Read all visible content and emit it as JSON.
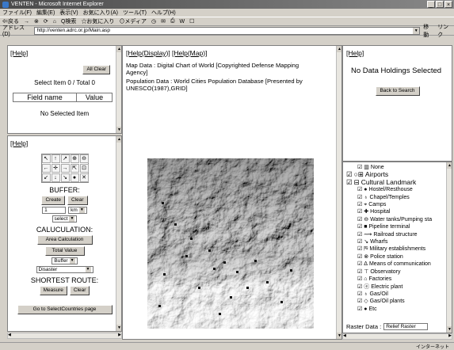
{
  "window": {
    "title": "VENTEN - Microsoft Internet Explorer",
    "min": "_",
    "max": "□",
    "close": "×"
  },
  "menu": [
    "ファイル(F)",
    "編集(E)",
    "表示(V)",
    "お気に入り(A)",
    "ツール(T)",
    "ヘルプ(H)"
  ],
  "toolbar": [
    "⇐戻る",
    "→",
    "⊗",
    "⟳",
    "⌂",
    "Q検索",
    "☆お気に入り",
    "⊙メディア",
    "◷",
    "✉",
    "⎙",
    "W",
    "☐"
  ],
  "address": {
    "label": "アドレス(D)",
    "url": "http://venten.adrc.or.jp/Main.asp",
    "go": "移動",
    "links": "リンク"
  },
  "top_left": {
    "help": "[Help]",
    "all_clear": "All Clear",
    "select_status": "Select Item 0 / Total 0",
    "col_field": "Field name",
    "col_value": "Value",
    "no_selected": "No Selected Item"
  },
  "tools": {
    "help": "[Help]",
    "icons": [
      "↖",
      "↑",
      "↗",
      "⊕",
      "⊖",
      "←",
      "✛",
      "→",
      "⇱",
      "⊡",
      "↙",
      "↓",
      "↘",
      "●",
      "✕"
    ],
    "buffer_title": "BUFFER:",
    "create": "Create",
    "clear": "Clear",
    "buffer_value": "1",
    "unit": "km",
    "select": "select",
    "calc_title": "CALUCULATION:",
    "area_calc": "Area Calculation",
    "total_value": "Total Value",
    "buffer_opt": "Buffer",
    "disaster": "Disaster",
    "route_title": "SHORTEST ROUTE:",
    "measure": "Measure",
    "route_clear": "Clear",
    "goto": "Go to SelectCountries page"
  },
  "map_panel": {
    "help_display": "[Help(Display)]",
    "help_map": "[Help(Map)]",
    "map_data": "Map Data : Digital Chart of World [Copyrighted Defense Mapping Agency]",
    "pop_data": "Population Data : World Cities Population Database [Presented by UNESCO(1987),GRID]"
  },
  "right_top": {
    "help": "[Help]",
    "no_data": "No Data Holdings Selected",
    "back": "Back to Search"
  },
  "legend": {
    "items": [
      {
        "check": "☑",
        "icon": "▥",
        "label": "None"
      },
      {
        "check": "☑",
        "icon": "○⊞",
        "label": "Airports",
        "big": true
      },
      {
        "check": "☑",
        "icon": "⊟",
        "label": "Cultural Landmark",
        "big": true
      },
      {
        "check": "☑",
        "icon": "●",
        "label": "Hostel/Resthouse"
      },
      {
        "check": "☑",
        "icon": "♁",
        "label": "Chapel/Temples"
      },
      {
        "check": "☑",
        "icon": "⌖",
        "label": "Camps"
      },
      {
        "check": "☑",
        "icon": "✚",
        "label": "Hospital"
      },
      {
        "check": "☑",
        "icon": "⊖",
        "label": "Water tanks/Pumping sta"
      },
      {
        "check": "☑",
        "icon": "■",
        "label": "Pipeline terminal"
      },
      {
        "check": "☑",
        "icon": "⟿",
        "label": "Railroad structure"
      },
      {
        "check": "☑",
        "icon": "↘",
        "label": "Wharfs"
      },
      {
        "check": "☑",
        "icon": "⛿",
        "label": "Military establishments"
      },
      {
        "check": "☑",
        "icon": "⊗",
        "label": "Police station"
      },
      {
        "check": "☑",
        "icon": "Δ",
        "label": "Means of communication"
      },
      {
        "check": "☑",
        "icon": "⊤",
        "label": "Observatory"
      },
      {
        "check": "☑",
        "icon": "⌂",
        "label": "Factories"
      },
      {
        "check": "☑",
        "icon": "ⓔ",
        "label": "Electric plant"
      },
      {
        "check": "☑",
        "icon": "♁",
        "label": "Gas/Oil"
      },
      {
        "check": "☑",
        "icon": "◇",
        "label": "Gas/Oil plants"
      },
      {
        "check": "☑",
        "icon": "●",
        "label": "Etc"
      }
    ],
    "raster_label": "Raster Data :",
    "raster_value": "Relief Raster"
  },
  "status": {
    "left": "",
    "right": "インターネット"
  }
}
